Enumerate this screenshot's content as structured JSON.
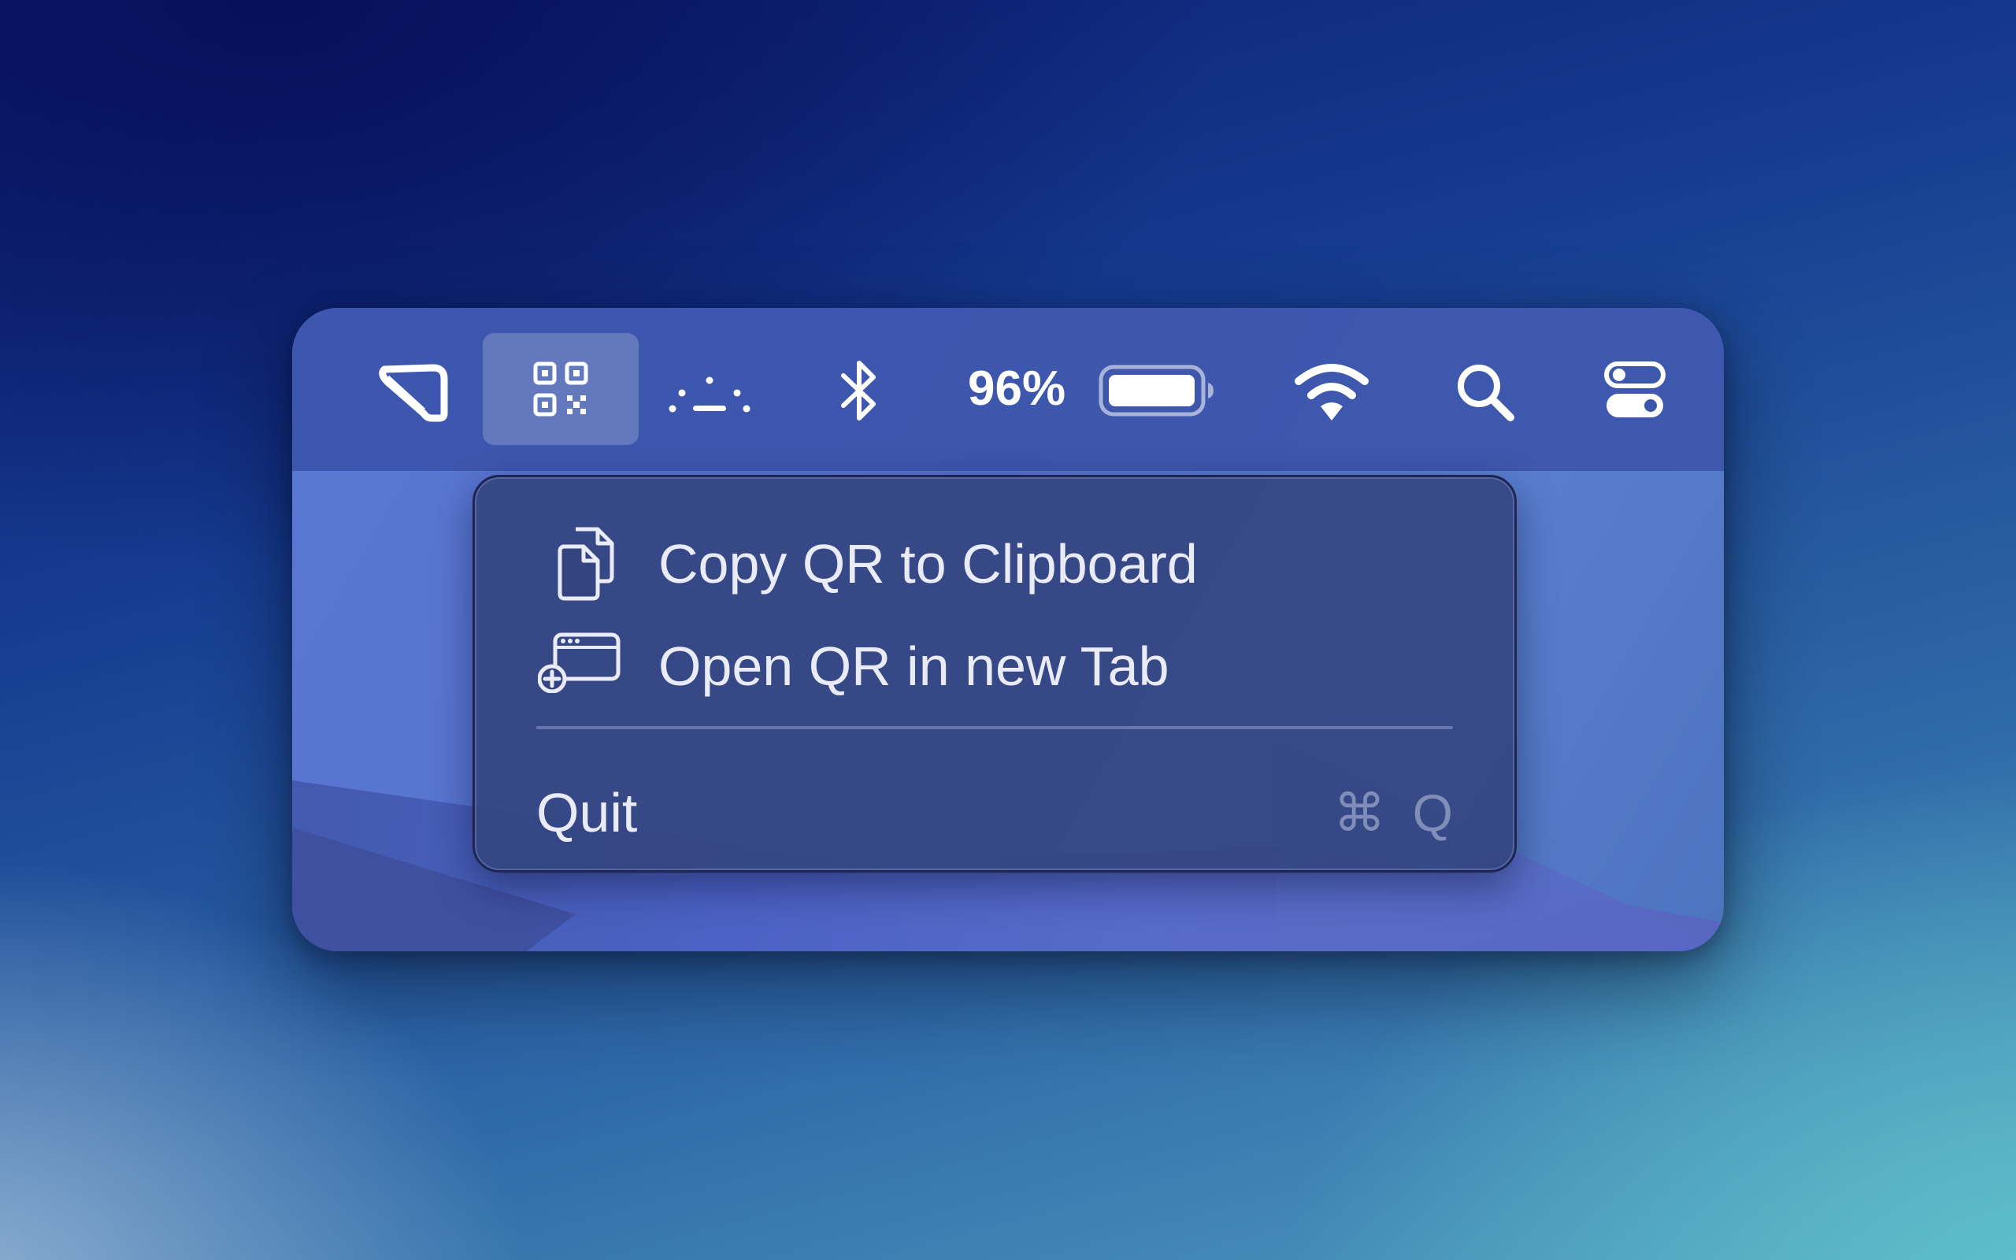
{
  "menubar": {
    "items": [
      {
        "icon": "app-outline-icon"
      },
      {
        "icon": "qr-code-icon",
        "selected": true
      },
      {
        "icon": "dotted-sleep-icon"
      },
      {
        "icon": "bluetooth-icon"
      },
      {
        "icon": "battery-icon"
      },
      {
        "icon": "wifi-icon"
      },
      {
        "icon": "search-icon"
      },
      {
        "icon": "control-center-icon"
      }
    ],
    "battery_percent_text": "96%",
    "battery_level": 0.96
  },
  "menu": {
    "items": [
      {
        "label": "Copy QR to Clipboard",
        "icon": "copy-documents-icon"
      },
      {
        "label": "Open QR in new Tab",
        "icon": "new-tab-window-icon"
      }
    ],
    "quit": {
      "label": "Quit",
      "shortcut": "⌘ Q"
    }
  },
  "colors": {
    "menubar": "#3c55aa",
    "menu_bg": "#344480",
    "menu_text": "#e9ebf6",
    "shortcut_text": "#bec6e1"
  }
}
